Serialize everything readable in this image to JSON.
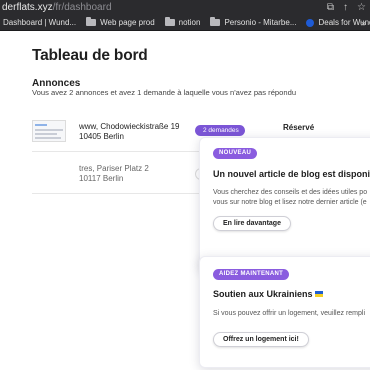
{
  "browser": {
    "url_host": "derflats.xyz",
    "url_path": "/fr/dashboard",
    "bookmarks": [
      {
        "label": "Dashboard | Wund...",
        "icon": "none"
      },
      {
        "label": "Web page prod",
        "icon": "folder-icon"
      },
      {
        "label": "notion",
        "icon": "folder-icon"
      },
      {
        "label": "Personio - Mitarbe...",
        "icon": "folder-icon"
      },
      {
        "label": "Deals for Wunderf...",
        "icon": "site-favicon"
      }
    ],
    "more_label": "»"
  },
  "dashboard": {
    "title": "Tableau de bord",
    "annonces_title": "Annonces",
    "annonces_subtitle": "Vous avez 2 annonces et avez 1 demande à laquelle vous n'avez pas répondu",
    "listings": [
      {
        "street": "www, Chodowieckistraße 19",
        "city": "10405 Berlin",
        "demand_label": "2 demandes",
        "status": "Réservé"
      },
      {
        "street": "tres, Pariser Platz 2",
        "city": "10117 Berlin"
      }
    ]
  },
  "cards": [
    {
      "badge": "NOUVEAU",
      "title": "Un nouvel article de blog est disponible",
      "text_line1": "Vous cherchez des conseils et des idées utiles po",
      "text_line2": "vous sur notre blog et lisez notre dernier article (e",
      "button": "En lire davantage"
    },
    {
      "badge": "AIDEZ MAINTENANT",
      "title": "Soutien aux Ukrainiens",
      "text_line1": "Si vous pouvez offrir un logement, veuillez rempli",
      "button": "Offrez un logement ici!"
    }
  ],
  "colors": {
    "accent": "#8a5cdf",
    "chrome_bg": "#2b2b2e"
  }
}
